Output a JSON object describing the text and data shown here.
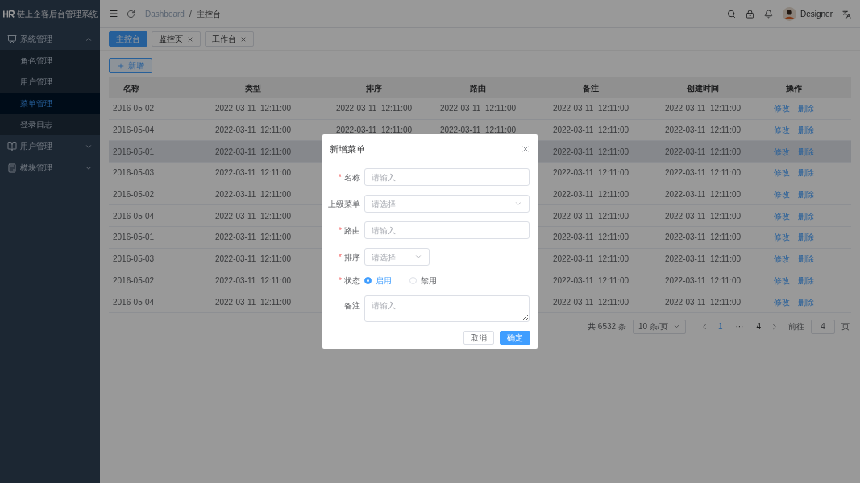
{
  "sidebar": {
    "title": "链上企客后台管理系统",
    "menus": [
      {
        "label": "系统管理",
        "expanded": true,
        "children": [
          {
            "label": "角色管理",
            "selected": false
          },
          {
            "label": "用户管理",
            "selected": false
          },
          {
            "label": "菜单管理",
            "selected": true
          },
          {
            "label": "登录日志",
            "selected": false
          }
        ]
      },
      {
        "label": "用户管理",
        "expanded": false
      },
      {
        "label": "模块管理",
        "expanded": false
      }
    ]
  },
  "header": {
    "breadcrumb": [
      "Dashboard",
      "主控台"
    ],
    "separator": "/",
    "user": "Designer"
  },
  "tabs": [
    {
      "label": "主控台",
      "selected": true,
      "closable": false
    },
    {
      "label": "监控页",
      "selected": false,
      "closable": true
    },
    {
      "label": "工作台",
      "selected": false,
      "closable": true
    }
  ],
  "add_button": "新增",
  "table": {
    "columns": [
      "名称",
      "类型",
      "排序",
      "路由",
      "备注",
      "创建时间",
      "操作"
    ],
    "rows": [
      {
        "name": "2016-05-02",
        "type": "2022-03-11  12:11:00",
        "sort": "2022-03-11  12:11:00",
        "route": "2022-03-11  12:11:00",
        "note": "2022-03-11  12:11:00",
        "created": "2022-03-11  12:11:00",
        "edit": "修改",
        "delete": "删除",
        "hovered": false
      },
      {
        "name": "2016-05-04",
        "type": "2022-03-11  12:11:00",
        "sort": "2022-03-11  12:11:00",
        "route": "2022-03-11  12:11:00",
        "note": "2022-03-11  12:11:00",
        "created": "2022-03-11  12:11:00",
        "edit": "修改",
        "delete": "删除",
        "hovered": false
      },
      {
        "name": "2016-05-01",
        "type": "2022-03-11  12:11:00",
        "note": "2022-03-11  12:11:00",
        "created": "2022-03-11  12:11:00",
        "edit": "修改",
        "delete": "删除",
        "hovered": true
      },
      {
        "name": "2016-05-03",
        "type": "2022-03-11  12:11:00",
        "note": "2022-03-11  12:11:00",
        "created": "2022-03-11  12:11:00",
        "edit": "修改",
        "delete": "删除",
        "hovered": false
      },
      {
        "name": "2016-05-02",
        "type": "2022-03-11  12:11:00",
        "note": "2022-03-11  12:11:00",
        "created": "2022-03-11  12:11:00",
        "edit": "修改",
        "delete": "删除",
        "hovered": false
      },
      {
        "name": "2016-05-04",
        "type": "2022-03-11  12:11:00",
        "note": "2022-03-11  12:11:00",
        "created": "2022-03-11  12:11:00",
        "edit": "修改",
        "delete": "删除",
        "hovered": false
      },
      {
        "name": "2016-05-01",
        "type": "2022-03-11  12:11:00",
        "note": "2022-03-11  12:11:00",
        "created": "2022-03-11  12:11:00",
        "edit": "修改",
        "delete": "删除",
        "hovered": false
      },
      {
        "name": "2016-05-03",
        "type": "2022-03-11  12:11:00",
        "note": "2022-03-11  12:11:00",
        "created": "2022-03-11  12:11:00",
        "edit": "修改",
        "delete": "删除",
        "hovered": false
      },
      {
        "name": "2016-05-02",
        "type": "2022-03-11  12:11:00",
        "note": "2022-03-11  12:11:00",
        "created": "2022-03-11  12:11:00",
        "edit": "修改",
        "delete": "删除",
        "hovered": false
      },
      {
        "name": "2016-05-04",
        "type": "2022-03-11  12:11:00",
        "note": "2022-03-11  12:11:00",
        "created": "2022-03-11  12:11:00",
        "edit": "修改",
        "delete": "删除",
        "hovered": false
      }
    ]
  },
  "pagination": {
    "total": "共 6532 条",
    "page_size": "10 条/页",
    "pages": [
      {
        "label": "1",
        "selected": true
      },
      {
        "label": "···",
        "selected": false
      },
      {
        "label": "4",
        "selected": false
      }
    ],
    "goto_label": "前往",
    "goto_value": "4",
    "goto_suffix": "页"
  },
  "dialog": {
    "title": "新增菜单",
    "required_mark": "*",
    "fields": [
      {
        "kind": "input",
        "label": "名称",
        "required": true,
        "placeholder": "请输入"
      },
      {
        "kind": "select",
        "label": "上级菜单",
        "required": false,
        "placeholder": "请选择",
        "wide": true
      },
      {
        "kind": "input",
        "label": "路由",
        "required": true,
        "placeholder": "请输入"
      },
      {
        "kind": "select",
        "label": "排序",
        "required": true,
        "placeholder": "请选择",
        "wide": false
      },
      {
        "kind": "radio",
        "label": "状态",
        "required": true,
        "options": [
          {
            "label": "启用",
            "selected": true
          },
          {
            "label": "禁用",
            "selected": false
          }
        ]
      },
      {
        "kind": "textarea",
        "label": "备注",
        "required": false,
        "placeholder": "请输入"
      }
    ],
    "buttons": [
      {
        "label": "取消",
        "kind": "default"
      },
      {
        "label": "确定",
        "kind": "primary"
      }
    ]
  }
}
